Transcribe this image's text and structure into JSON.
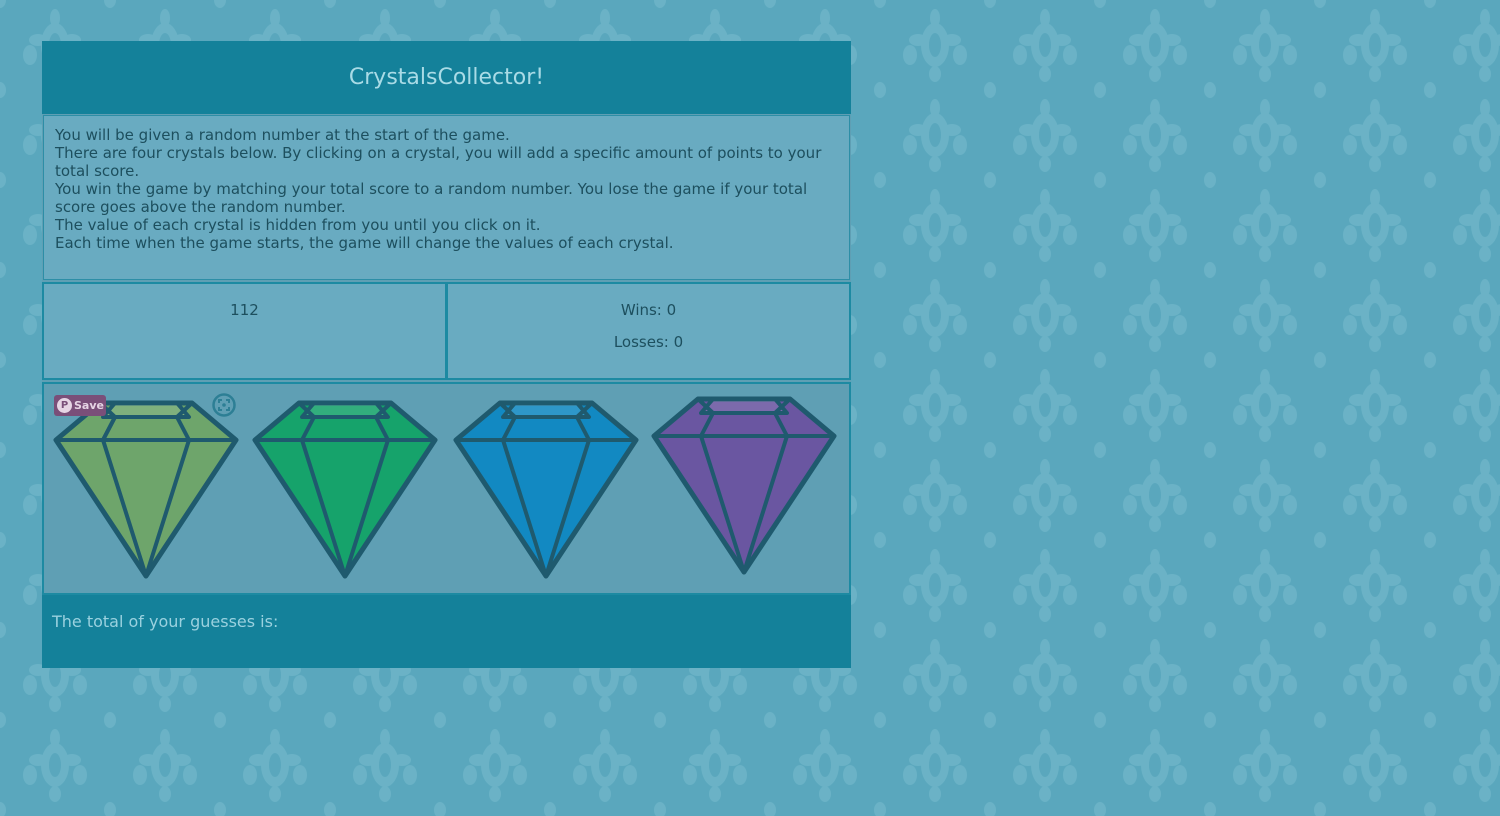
{
  "header": {
    "title": "CrystalsCollector!"
  },
  "instructions": [
    "You will be given a random number at the start of the game.",
    "There are four crystals below. By clicking on a crystal, you will add a specific amount of points to your total score.",
    "You win the game by matching your total score to a random number. You lose the game if your total score goes above the random number.",
    "The value of each crystal is hidden from you until you click on it.",
    "Each time when the game starts, the game will change the values of each crystal."
  ],
  "scoreboard": {
    "target_number": "112",
    "wins": "Wins: 0",
    "losses": "Losses: 0"
  },
  "pin_button": {
    "label": "Save",
    "icon": "pinterest-icon"
  },
  "crystals": [
    {
      "name": "green-crystal",
      "color": "#6ea56b"
    },
    {
      "name": "emerald-crystal",
      "color": "#16a36b"
    },
    {
      "name": "blue-crystal",
      "color": "#1289c2"
    },
    {
      "name": "purple-crystal",
      "color": "#6a56a1"
    }
  ],
  "footer": {
    "total_label": "The total of your guesses is:"
  },
  "colors": {
    "background": "#5aa7bd",
    "header": "#14819a",
    "panel": "#69abc1",
    "crystal_outline": "#1f5a6e"
  }
}
